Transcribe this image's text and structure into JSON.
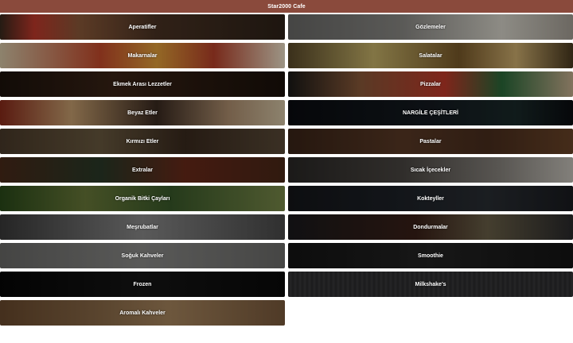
{
  "header": {
    "title": "Star2000 Cafe",
    "background": "#8a4a3c"
  },
  "categories": [
    {
      "label": "Aperatifler",
      "key": "aperatif"
    },
    {
      "label": "Gözlemeler",
      "key": "gozleme"
    },
    {
      "label": "Makarnalar",
      "key": "makarna"
    },
    {
      "label": "Salatalar",
      "key": "salata"
    },
    {
      "label": "Ekmek Arası Lezzetler",
      "key": "ekmek"
    },
    {
      "label": "Pizzalar",
      "key": "pizza"
    },
    {
      "label": "Beyaz Etler",
      "key": "beyaz"
    },
    {
      "label": "NARGİLE ÇEŞİTLERİ",
      "key": "nargile"
    },
    {
      "label": "Kırmızı Etler",
      "key": "kirmizi"
    },
    {
      "label": "Pastalar",
      "key": "pasta"
    },
    {
      "label": "Extralar",
      "key": "ekstra"
    },
    {
      "label": "Sıcak İçecekler",
      "key": "sicak"
    },
    {
      "label": "Organik Bitki Çayları",
      "key": "organik"
    },
    {
      "label": "Kokteyller",
      "key": "kokteyl"
    },
    {
      "label": "Meşrubatlar",
      "key": "mesrubat"
    },
    {
      "label": "Dondurmalar",
      "key": "dondurma"
    },
    {
      "label": "Soğuk Kahveler",
      "key": "soguk"
    },
    {
      "label": "Smoothie",
      "key": "smoothie"
    },
    {
      "label": "Frozen",
      "key": "frozen"
    },
    {
      "label": "Milkshake's",
      "key": "milkshake"
    },
    {
      "label": "Aromalı Kahveler",
      "key": "aromali"
    }
  ]
}
